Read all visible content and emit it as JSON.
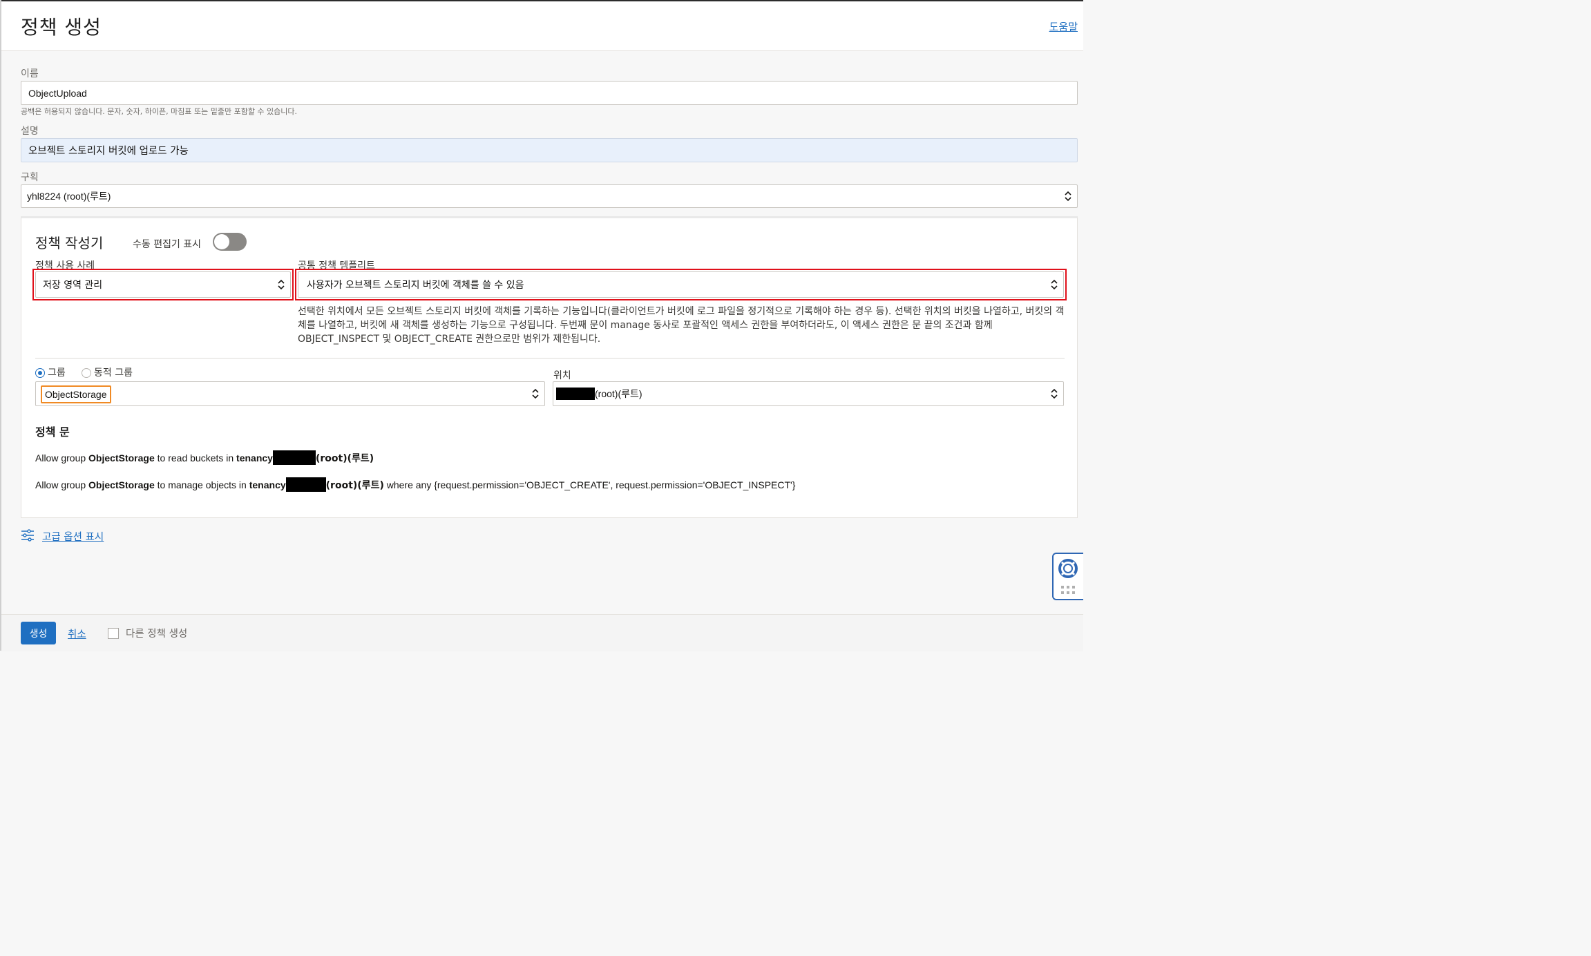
{
  "header": {
    "title": "정책 생성",
    "help_label": "도움말"
  },
  "form": {
    "name": {
      "label": "이름",
      "value": "ObjectUpload",
      "hint": "공백은 허용되지 않습니다. 문자, 숫자, 하이픈, 마침표 또는 밑줄만 포함할 수 있습니다."
    },
    "description": {
      "label": "설명",
      "value": "오브젝트 스토리지 버킷에 업로드 가능"
    },
    "compartment": {
      "label": "구획",
      "value": "yhl8224 (root)(루트)"
    }
  },
  "composer": {
    "title": "정책 작성기",
    "manual_editor_label": "수동 편집기 표시",
    "manual_editor_on": false,
    "use_case": {
      "label": "정책 사용 사례",
      "value": "저장 영역 관리"
    },
    "template": {
      "label": "공통 정책 템플리트",
      "value": "사용자가 오브젝트 스토리지 버킷에 객체를 쓸 수 있음"
    },
    "template_description": "선택한 위치에서 모든 오브젝트 스토리지 버킷에 객체를 기록하는 기능입니다(클라이언트가 버킷에 로그 파일을 정기적으로 기록해야 하는 경우 등). 선택한 위치의 버킷을 나열하고, 버킷의 객체를 나열하고, 버킷에 새 객체를 생성하는 기능으로 구성됩니다. 두번째 문이 manage 동사로 포괄적인 액세스 권한을 부여하더라도, 이 액세스 권한은 문 끝의 조건과 함께 OBJECT_INSPECT 및 OBJECT_CREATE 권한으로만 범위가 제한됩니다.",
    "group_type": {
      "group_label": "그룹",
      "dynamic_group_label": "동적 그룹",
      "selected": "group"
    },
    "group_value": "ObjectStorage",
    "location": {
      "label": "위치",
      "value_suffix": "(root)(루트)"
    },
    "statements_title": "정책 문",
    "statement1": {
      "allow": "Allow group",
      "group": "ObjectStorage",
      "middle": "to read buckets in",
      "tenancy": "tenancy",
      "root": "(root)(루트)"
    },
    "statement2": {
      "allow": "Allow group",
      "group": "ObjectStorage",
      "middle": "to manage objects in",
      "tenancy": "tenancy",
      "root": "(root)(루트)",
      "condition": "where any {request.permission='OBJECT_CREATE', request.permission='OBJECT_INSPECT'}"
    }
  },
  "advanced_label": "고급 옵션 표시",
  "footer": {
    "create_label": "생성",
    "cancel_label": "취소",
    "another_label": "다른 정책 생성"
  },
  "colors": {
    "accent": "#1f6fc1",
    "highlight_red": "#e0101a",
    "highlight_orange": "#f08a24"
  }
}
